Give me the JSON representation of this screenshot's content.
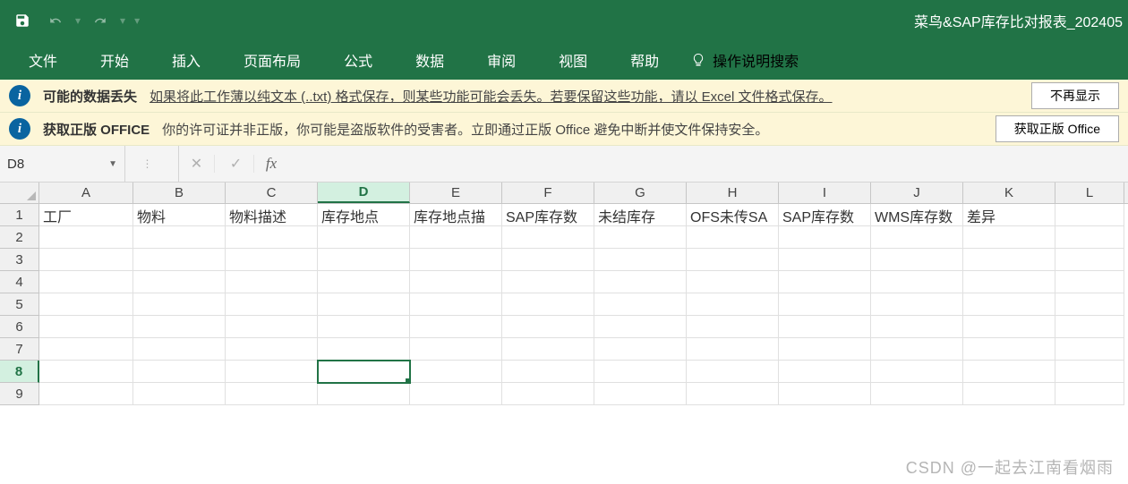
{
  "titlebar": {
    "workbook_name": "菜鸟&SAP库存比对报表_202405"
  },
  "tabs": {
    "file": "文件",
    "home": "开始",
    "insert": "插入",
    "layout": "页面布局",
    "formulas": "公式",
    "data": "数据",
    "review": "审阅",
    "view": "视图",
    "help": "帮助",
    "tellme": "操作说明搜索"
  },
  "msg1": {
    "title": "可能的数据丢失",
    "text": "如果将此工作薄以纯文本 (..txt) 格式保存，则某些功能可能会丢失。若要保留这些功能，请以 Excel 文件格式保存。",
    "btn": "不再显示"
  },
  "msg2": {
    "title": "获取正版 OFFICE",
    "text": "你的许可证并非正版，你可能是盗版软件的受害者。立即通过正版 Office 避免中断并使文件保持安全。",
    "btn": "获取正版 Office"
  },
  "namebox": "D8",
  "fx": "fx",
  "cancel": "✕",
  "confirm": "✓",
  "columns": [
    "A",
    "B",
    "C",
    "D",
    "E",
    "F",
    "G",
    "H",
    "I",
    "J",
    "K",
    "L"
  ],
  "active_col": "D",
  "active_row": 8,
  "row_count": 9,
  "headers": {
    "A": "工厂",
    "B": "物料",
    "C": "物料描述",
    "D": "库存地点",
    "E": "库存地点描",
    "F": "SAP库存数",
    "G": "未结库存",
    "H": "OFS未传SA",
    "I": "SAP库存数",
    "J": "WMS库存数",
    "K": "差异"
  },
  "watermark": "CSDN @一起去江南看烟雨"
}
